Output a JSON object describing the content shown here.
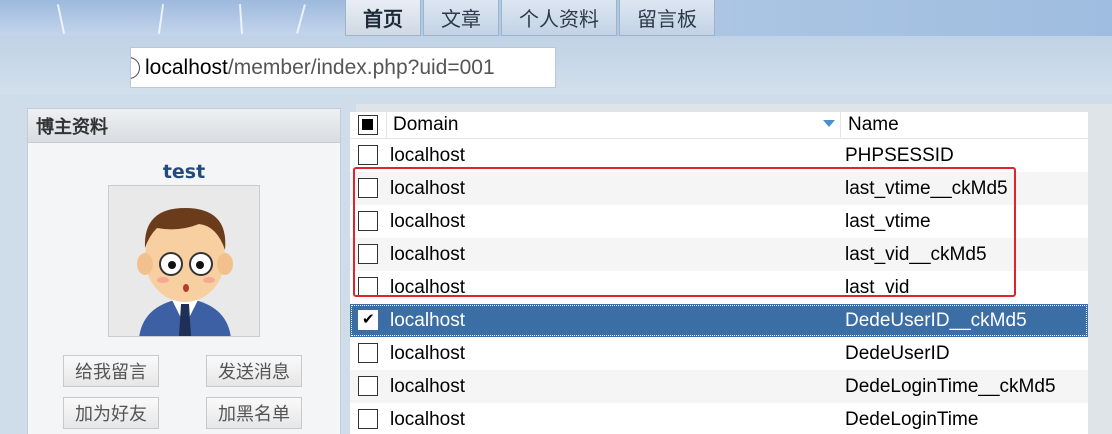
{
  "nav": {
    "tabs": [
      {
        "label": "首页",
        "active": true
      },
      {
        "label": "文章",
        "active": false
      },
      {
        "label": "个人资料",
        "active": false
      },
      {
        "label": "留言板",
        "active": false
      }
    ]
  },
  "address_bar": {
    "host": "localhost",
    "path": "/member/index.php?uid=001"
  },
  "profile": {
    "title": "博主资料",
    "username": "test",
    "avatar_icon": "cartoon-man-avatar",
    "buttons": {
      "leave_message": "给我留言",
      "send_message": "发送消息",
      "add_friend": "加为好友",
      "blacklist": "加黑名单"
    }
  },
  "cookies": {
    "columns": {
      "domain": "Domain",
      "name": "Name"
    },
    "rows": [
      {
        "domain": "localhost",
        "name": "PHPSESSID",
        "checked": false
      },
      {
        "domain": "localhost",
        "name": "last_vtime__ckMd5",
        "checked": false
      },
      {
        "domain": "localhost",
        "name": "last_vtime",
        "checked": false
      },
      {
        "domain": "localhost",
        "name": "last_vid__ckMd5",
        "checked": false
      },
      {
        "domain": "localhost",
        "name": "last_vid",
        "checked": false
      },
      {
        "domain": "localhost",
        "name": "DedeUserID__ckMd5",
        "checked": true
      },
      {
        "domain": "localhost",
        "name": "DedeUserID",
        "checked": false
      },
      {
        "domain": "localhost",
        "name": "DedeLoginTime__ckMd5",
        "checked": false
      },
      {
        "domain": "localhost",
        "name": "DedeLoginTime",
        "checked": false
      }
    ]
  },
  "colors": {
    "selected_row": "#3a6ea5",
    "highlight_box": "#e0242c",
    "username": "#244a7c"
  }
}
